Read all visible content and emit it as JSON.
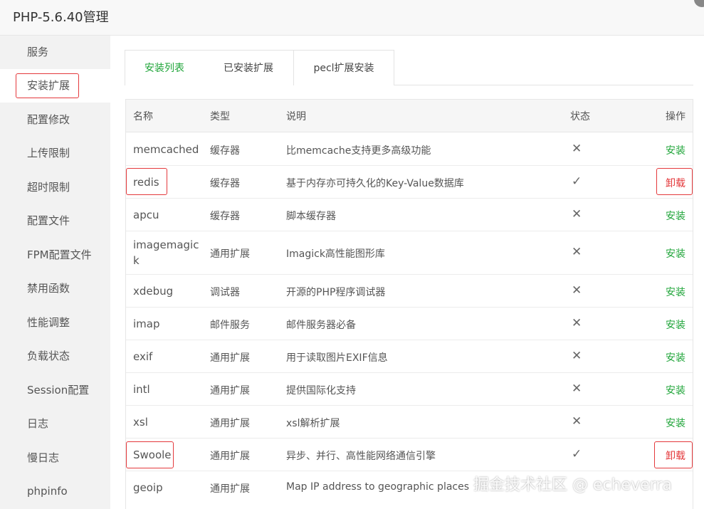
{
  "window": {
    "title": "PHP-5.6.40管理"
  },
  "sidebar": {
    "items": [
      {
        "label": "服务"
      },
      {
        "label": "安装扩展"
      },
      {
        "label": "配置修改"
      },
      {
        "label": "上传限制"
      },
      {
        "label": "超时限制"
      },
      {
        "label": "配置文件"
      },
      {
        "label": "FPM配置文件"
      },
      {
        "label": "禁用函数"
      },
      {
        "label": "性能调整"
      },
      {
        "label": "负载状态"
      },
      {
        "label": "Session配置"
      },
      {
        "label": "日志"
      },
      {
        "label": "慢日志"
      },
      {
        "label": "phpinfo"
      }
    ],
    "active_index": 1
  },
  "tabs": [
    {
      "label": "安装列表"
    },
    {
      "label": "已安装扩展"
    },
    {
      "label": "pecl扩展安装"
    }
  ],
  "table": {
    "headers": {
      "name": "名称",
      "type": "类型",
      "desc": "说明",
      "status": "状态",
      "action": "操作"
    },
    "rows": [
      {
        "name": "memcached",
        "type": "缓存器",
        "desc": "比memcache支持更多高级功能",
        "status": "✕",
        "action": "安装",
        "highlight": false
      },
      {
        "name": "redis",
        "type": "缓存器",
        "desc": "基于内存亦可持久化的Key-Value数据库",
        "status": "✓",
        "action": "卸载",
        "highlight": true
      },
      {
        "name": "apcu",
        "type": "缓存器",
        "desc": "脚本缓存器",
        "status": "✕",
        "action": "安装",
        "highlight": false
      },
      {
        "name": "imagemagick",
        "name_line1": "imagemagic",
        "name_line2": "k",
        "type": "通用扩展",
        "desc": "Imagick高性能图形库",
        "status": "✕",
        "action": "安装",
        "highlight": false
      },
      {
        "name": "xdebug",
        "type": "调试器",
        "desc": "开源的PHP程序调试器",
        "status": "✕",
        "action": "安装",
        "highlight": false
      },
      {
        "name": "imap",
        "type": "邮件服务",
        "desc": "邮件服务器必备",
        "status": "✕",
        "action": "安装",
        "highlight": false
      },
      {
        "name": "exif",
        "type": "通用扩展",
        "desc": "用于读取图片EXIF信息",
        "status": "✕",
        "action": "安装",
        "highlight": false
      },
      {
        "name": "intl",
        "type": "通用扩展",
        "desc": "提供国际化支持",
        "status": "✕",
        "action": "安装",
        "highlight": false
      },
      {
        "name": "xsl",
        "type": "通用扩展",
        "desc": "xsl解析扩展",
        "status": "✕",
        "action": "安装",
        "highlight": false
      },
      {
        "name": "Swoole",
        "type": "通用扩展",
        "desc": "异步、并行、高性能网络通信引擎",
        "status": "✓",
        "action": "卸载",
        "highlight": true
      },
      {
        "name": "geoip",
        "type": "通用扩展",
        "desc": "Map IP address to geographic places",
        "status": "",
        "action": "",
        "highlight": false
      }
    ]
  },
  "watermark": "掘金技术社区 @ echeverra",
  "colors": {
    "accent_green": "#20a53a",
    "highlight_red": "#e4393c"
  }
}
